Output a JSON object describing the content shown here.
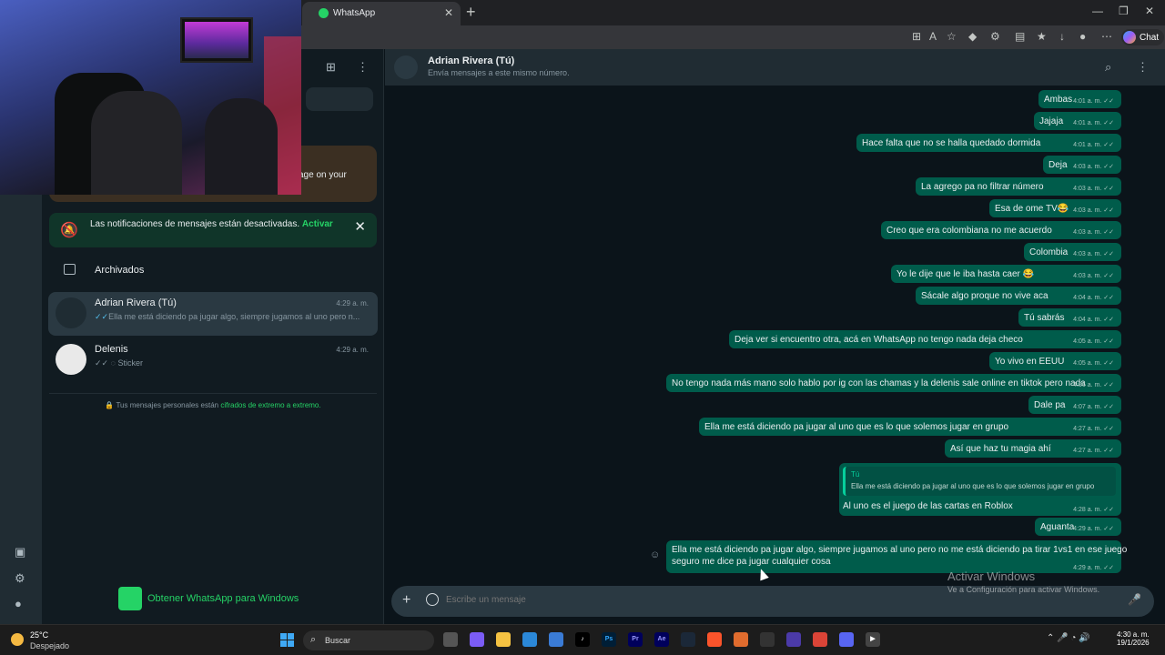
{
  "browser": {
    "tab_title": "WhatsApp",
    "chat_button": "Chat"
  },
  "sidebar": {
    "promo_text": "age on your",
    "notification": {
      "text": "Las notificaciones de mensajes están desactivadas.",
      "action": "Activar"
    },
    "archived_label": "Archivados",
    "chats": [
      {
        "name": "Adrian Rivera (Tú)",
        "time": "4:29 a. m.",
        "preview": "Ella me está diciendo pa jugar algo, siempre jugamos al uno pero n..."
      },
      {
        "name": "Delenis",
        "time": "4:29 a. m.",
        "preview": "Sticker"
      }
    ],
    "e2e_text": "Tus mensajes personales están",
    "e2e_link": "cifrados de extremo a extremo.",
    "get_app": "Obtener WhatsApp para Windows"
  },
  "conversation": {
    "title": "Adrian Rivera (Tú)",
    "subtitle": "Envía mensajes a este mismo número.",
    "messages": [
      {
        "text": "Ambas",
        "time": "4:01 a. m."
      },
      {
        "text": "Jajaja",
        "time": "4:01 a. m."
      },
      {
        "text": "Hace falta que no se halla quedado dormida",
        "time": "4:01 a. m."
      },
      {
        "text": "Deja",
        "time": "4:03 a. m."
      },
      {
        "text": "La agrego pa no filtrar número",
        "time": "4:03 a. m."
      },
      {
        "text": "Esa de ome TV😂",
        "time": "4:03 a. m."
      },
      {
        "text": "Creo que era colombiana no me acuerdo",
        "time": "4:03 a. m."
      },
      {
        "text": "Colombia",
        "time": "4:03 a. m."
      },
      {
        "text": "Yo le dije que le iba hasta caer 😂",
        "time": "4:03 a. m."
      },
      {
        "text": "Sácale algo proque no vive aca",
        "time": "4:04 a. m."
      },
      {
        "text": "Tú sabrás",
        "time": "4:04 a. m."
      },
      {
        "text": "Deja ver si encuentro otra, acá en WhatsApp no tengo nada deja checo",
        "time": "4:05 a. m."
      },
      {
        "text": "Yo vivo en EEUU",
        "time": "4:05 a. m."
      },
      {
        "text": "No tengo nada más mano solo hablo por ig con las chamas y la delenis sale online en tiktok pero nada",
        "time": "4:06 a. m."
      },
      {
        "text": "Dale pa",
        "time": "4:07 a. m."
      },
      {
        "text": "Ella me está diciendo pa jugar al uno que es lo que solemos jugar en grupo",
        "time": "4:27 a. m."
      },
      {
        "text": "Así que haz tu magia ahí",
        "time": "4:27 a. m."
      }
    ],
    "reply": {
      "quoted_author": "Tú",
      "quoted_text": "Ella me está diciendo pa jugar al uno que es lo que solemos jugar en grupo",
      "text": "Al uno es el juego de las cartas en Roblox",
      "time": "4:28 a. m."
    },
    "aguanta": {
      "text": "Aguanta",
      "time": "4:29 a. m."
    },
    "last": {
      "line1": "Ella me está diciendo pa jugar algo, siempre jugamos al uno pero no me está diciendo pa tirar 1vs1 en ese juego",
      "line2": "seguro me dice pa jugar cualquier cosa",
      "time": "4:29 a. m."
    },
    "composer_placeholder": "Escribe un mensaje"
  },
  "watermark": {
    "line1": "Activar Windows",
    "line2": "Ve a Configuración para activar Windows."
  },
  "taskbar": {
    "temp": "25°C",
    "condition": "Despejado",
    "search": "Buscar",
    "time": "4:30 a. m.",
    "date": "19/1/2026"
  }
}
